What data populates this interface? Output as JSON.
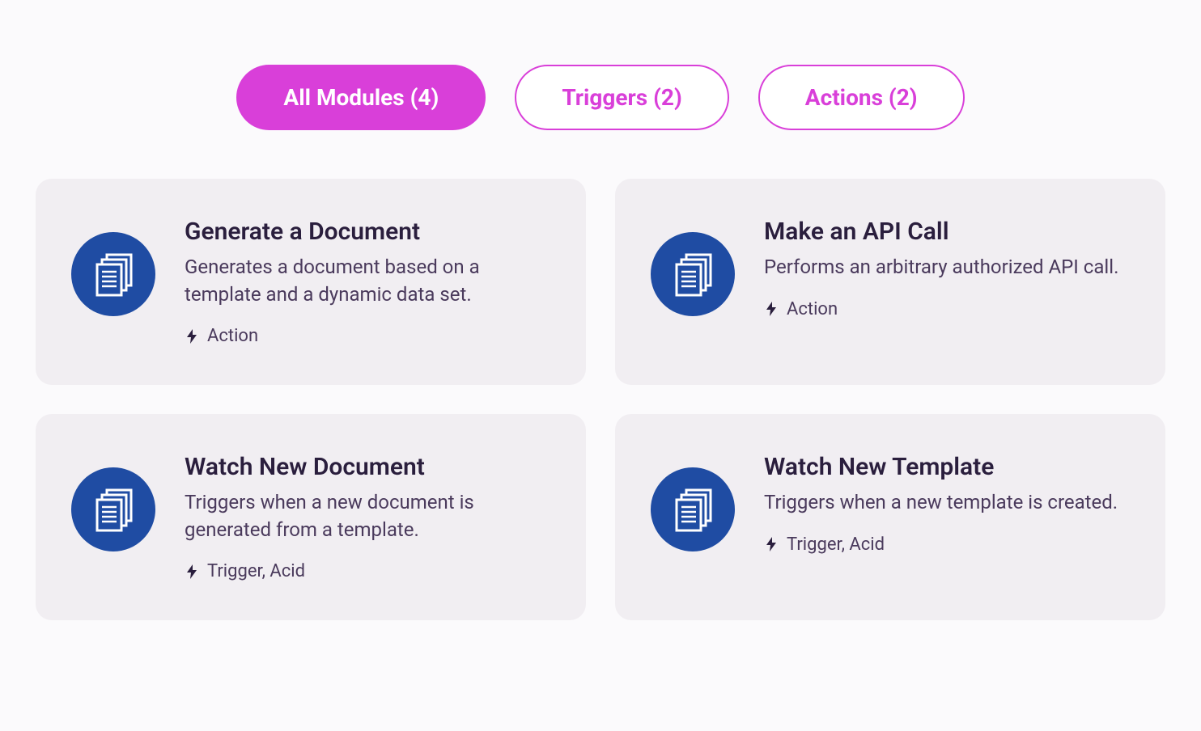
{
  "tabs": [
    {
      "label": "All Modules (4)",
      "active": true
    },
    {
      "label": "Triggers (2)",
      "active": false
    },
    {
      "label": "Actions (2)",
      "active": false
    }
  ],
  "cards": [
    {
      "title": "Generate a Document",
      "desc": "Generates a document based on a template and a dynamic data set.",
      "type": "Action"
    },
    {
      "title": "Make an API Call",
      "desc": "Performs an arbitrary authorized API call.",
      "type": "Action"
    },
    {
      "title": "Watch New Document",
      "desc": "Triggers when a new document is generated from a template.",
      "type": "Trigger, Acid"
    },
    {
      "title": "Watch New Template",
      "desc": "Triggers when a new template is created.",
      "type": "Trigger, Acid"
    }
  ]
}
